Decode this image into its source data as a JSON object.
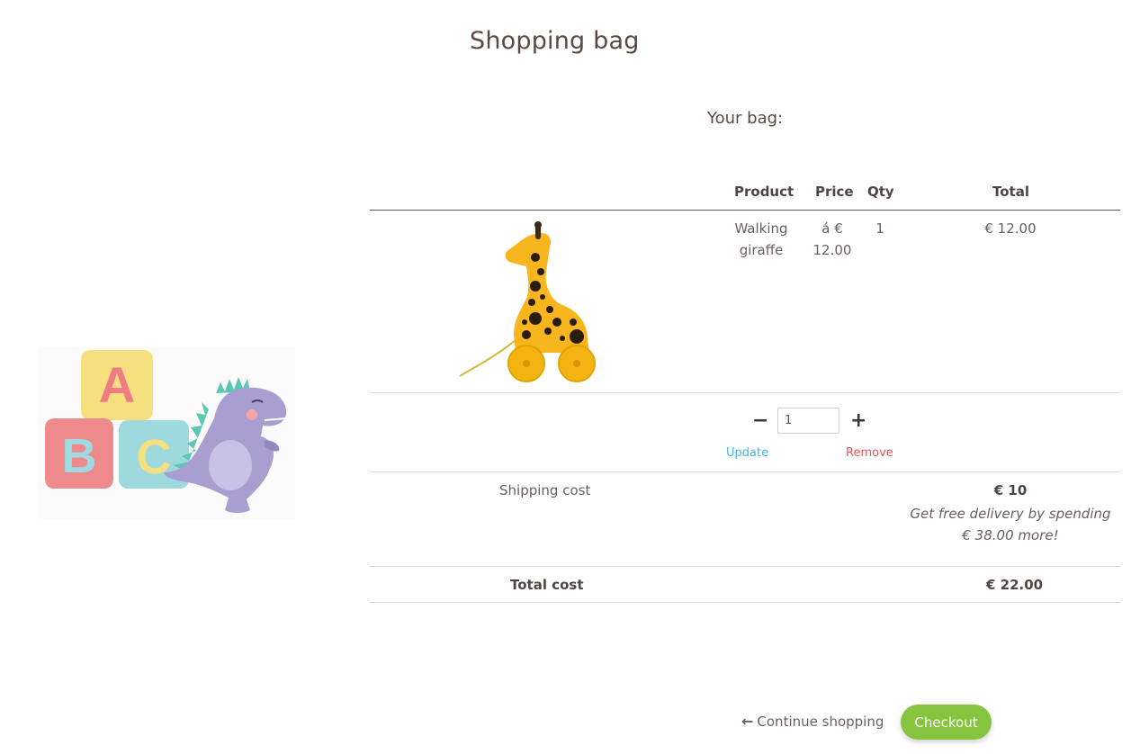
{
  "page": {
    "title": "Shopping bag",
    "bag_heading": "Your bag:"
  },
  "table": {
    "headers": {
      "product": "Product",
      "price": "Price",
      "qty": "Qty",
      "total": "Total"
    },
    "item": {
      "image": "walking-giraffe-toy",
      "name_line1": "Walking",
      "name_line2": "giraffe",
      "price_line1": "á €",
      "price_line2": "12.00",
      "qty": "1",
      "total": "€ 12.00"
    }
  },
  "qty_controls": {
    "minus_icon": "minus-icon",
    "plus_icon": "plus-icon",
    "value": "1",
    "update_label": "Update",
    "remove_label": "Remove"
  },
  "shipping": {
    "label": "Shipping cost",
    "value": "€ 10",
    "note_line1": "Get free delivery by spending",
    "note_line2": "€ 38.00 more!"
  },
  "totals": {
    "label": "Total cost",
    "value": "€ 22.00"
  },
  "actions": {
    "continue_label": "Continue shopping",
    "checkout_label": "Checkout"
  },
  "colors": {
    "update_link": "#4bb7d6",
    "remove_link": "#e0565b",
    "checkout_button": "#86c43f"
  }
}
